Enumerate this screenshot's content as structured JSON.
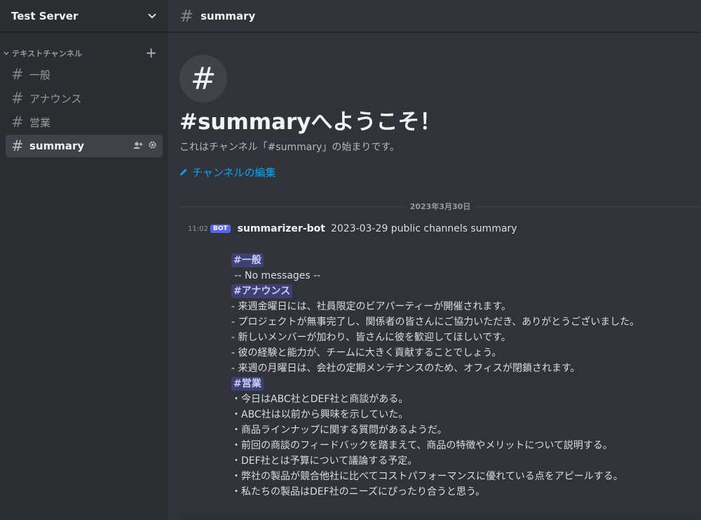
{
  "server": {
    "name": "Test Server"
  },
  "sidebar": {
    "category": "テキストチャンネル",
    "channels": [
      {
        "name": "一般"
      },
      {
        "name": "アナウンス"
      },
      {
        "name": "営業"
      },
      {
        "name": "summary",
        "active": true
      }
    ]
  },
  "header": {
    "channel": "summary"
  },
  "welcome": {
    "icon": "#",
    "title": "#summaryへようこそ！",
    "subtitle": "これはチャンネル「#summary」の始まりです。",
    "edit_label": "チャンネルの編集"
  },
  "date_divider": "2023年3月30日",
  "message": {
    "time": "11:02",
    "bot_tag": "BOT",
    "author": "summarizer-bot",
    "header_text": "2023-03-29 public channels summary",
    "sections": [
      {
        "channel": "#一般",
        "lines": [
          " -- No messages --"
        ]
      },
      {
        "channel": "#アナウンス",
        "lines": [
          "- 来週金曜日には、社員限定のビアパーティーが開催されます。",
          "- プロジェクトが無事完了し、関係者の皆さんにご協力いただき、ありがとうございました。",
          "- 新しいメンバーが加わり、皆さんに彼を歓迎してほしいです。",
          "- 彼の経験と能力が、チームに大きく貢献することでしょう。",
          "- 来週の月曜日は、会社の定期メンテナンスのため、オフィスが閉鎖されます。"
        ]
      },
      {
        "channel": "#営業",
        "lines": [
          "・今日はABC社とDEF社と商談がある。",
          "・ABC社は以前から興味を示していた。",
          "・商品ラインナップに関する質問があるようだ。",
          "・前回の商談のフィードバックを踏まえて、商品の特徴やメリットについて説明する。",
          "・DEF社とは予算について議論する予定。",
          "・弊社の製品が競合他社に比べてコストパフォーマンスに優れている点をアピールする。",
          "・私たちの製品はDEF社のニーズにぴったり合うと思う。"
        ]
      }
    ]
  },
  "colors": {
    "accent": "#5865f2",
    "link": "#00a8fc",
    "bg": "#313338",
    "sidebar": "#2b2d31"
  }
}
